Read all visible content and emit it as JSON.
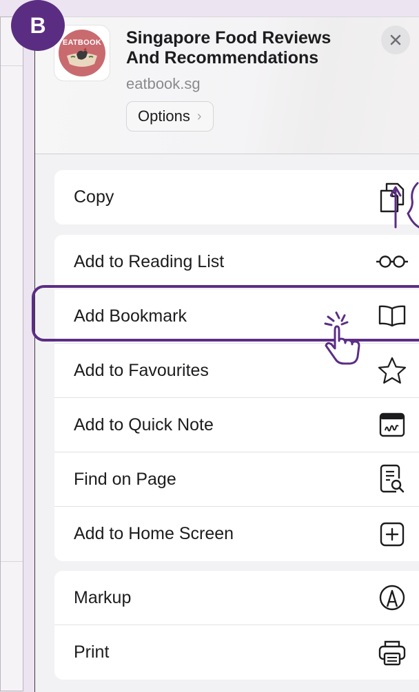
{
  "badge": {
    "letter": "B"
  },
  "header": {
    "logo_text": "EATBOOK",
    "title": "Singapore Food Reviews And Recommendations",
    "url": "eatbook.sg",
    "options_label": "Options"
  },
  "groups": [
    {
      "items": [
        {
          "label": "Copy",
          "icon": "copy-icon"
        }
      ]
    },
    {
      "items": [
        {
          "label": "Add to Reading List",
          "icon": "glasses-icon"
        },
        {
          "label": "Add Bookmark",
          "icon": "book-icon"
        },
        {
          "label": "Add to Favourites",
          "icon": "star-icon"
        },
        {
          "label": "Add to Quick Note",
          "icon": "quick-note-icon"
        },
        {
          "label": "Find on Page",
          "icon": "find-doc-icon"
        },
        {
          "label": "Add to Home Screen",
          "icon": "plus-square-icon"
        }
      ]
    },
    {
      "items": [
        {
          "label": "Markup",
          "icon": "markup-icon"
        },
        {
          "label": "Print",
          "icon": "printer-icon"
        }
      ]
    }
  ],
  "colors": {
    "badge": "#5a2d82",
    "highlight": "#5b2d84",
    "sheet_bg": "#f2f2f4",
    "logo_red": "#c96a6f"
  }
}
